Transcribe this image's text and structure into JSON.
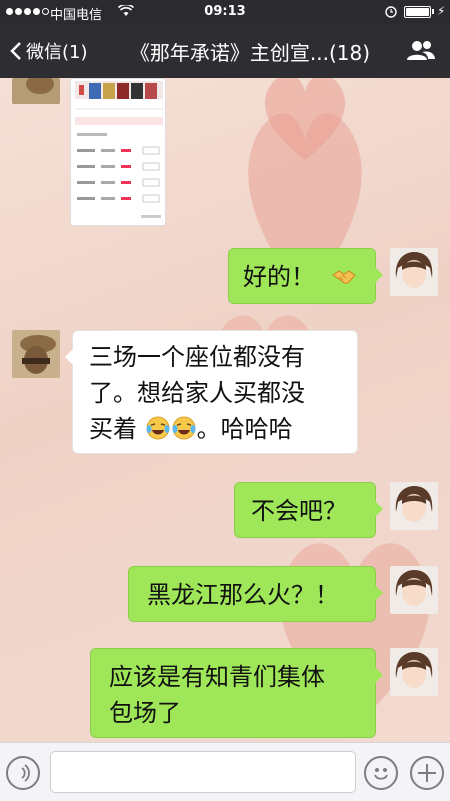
{
  "status_bar": {
    "carrier": "中国电信",
    "time": "09:13",
    "signal_bars_filled": 4,
    "signal_bars_total": 5,
    "battery_level": 1.0
  },
  "nav": {
    "back_label": "微信(1)",
    "title": "《那年承诺》主创宣...(18)"
  },
  "messages": [
    {
      "side": "left",
      "type": "image",
      "sender": "group-member",
      "text": ""
    },
    {
      "side": "right",
      "type": "text",
      "sender": "me",
      "text": "好的！",
      "emoji": "handshake-emoji"
    },
    {
      "side": "left",
      "type": "text",
      "sender": "group-member",
      "lines": [
        "三场一个座位都没有",
        "了。想给家人买都没",
        "买着"
      ],
      "tail_text": "。哈哈哈",
      "emoji": "tears-of-joy-emoji"
    },
    {
      "side": "right",
      "type": "text",
      "sender": "me",
      "text": "不会吧？"
    },
    {
      "side": "right",
      "type": "text",
      "sender": "me",
      "text": "黑龙江那么火？！"
    },
    {
      "side": "right",
      "type": "text",
      "sender": "me",
      "lines": [
        "应该是有知青们集体",
        "包场了"
      ]
    }
  ],
  "input_bar": {
    "placeholder": "",
    "voice_icon": "voice-icon",
    "emoji_icon": "emoji-icon",
    "plus_icon": "plus-icon"
  },
  "colors": {
    "bubble_green": "#9fe658",
    "nav_bg": "#2e2d32",
    "status_bg": "#2b2a2f"
  }
}
